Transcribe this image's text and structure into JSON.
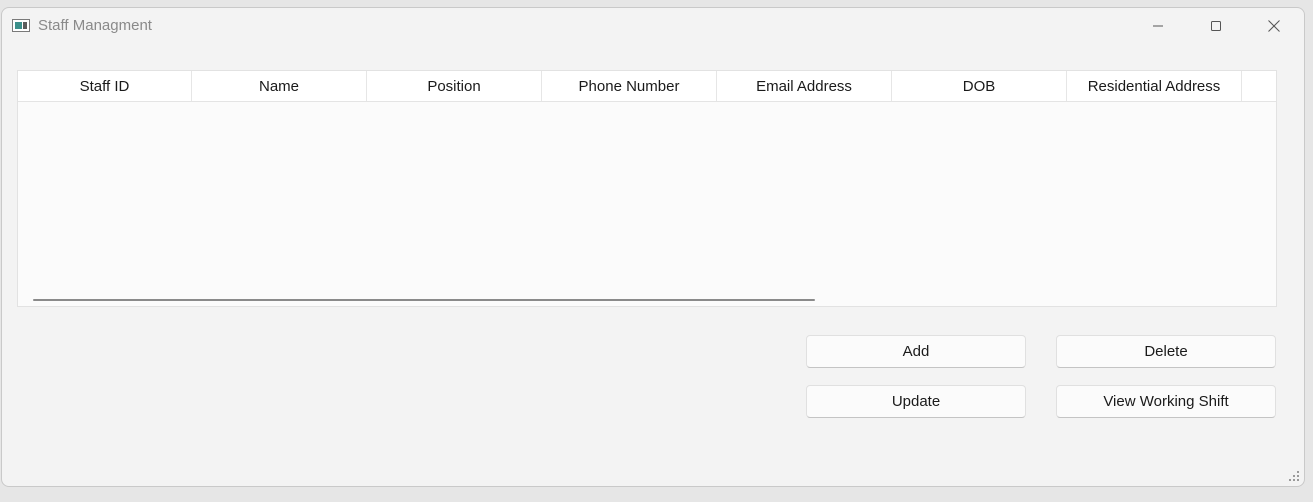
{
  "window": {
    "title": "Staff Managment"
  },
  "table": {
    "columns": [
      "Staff ID",
      "Name",
      "Position",
      "Phone Number",
      "Email Address",
      "DOB",
      "Residential Address"
    ],
    "rows": []
  },
  "buttons": {
    "add": "Add",
    "delete": "Delete",
    "update": "Update",
    "view_working_shift": "View Working Shift"
  },
  "icons": {
    "app": "app-window-icon",
    "minimize": "minimize-icon",
    "maximize": "maximize-icon",
    "close": "close-icon",
    "resize": "resize-grip-icon"
  }
}
